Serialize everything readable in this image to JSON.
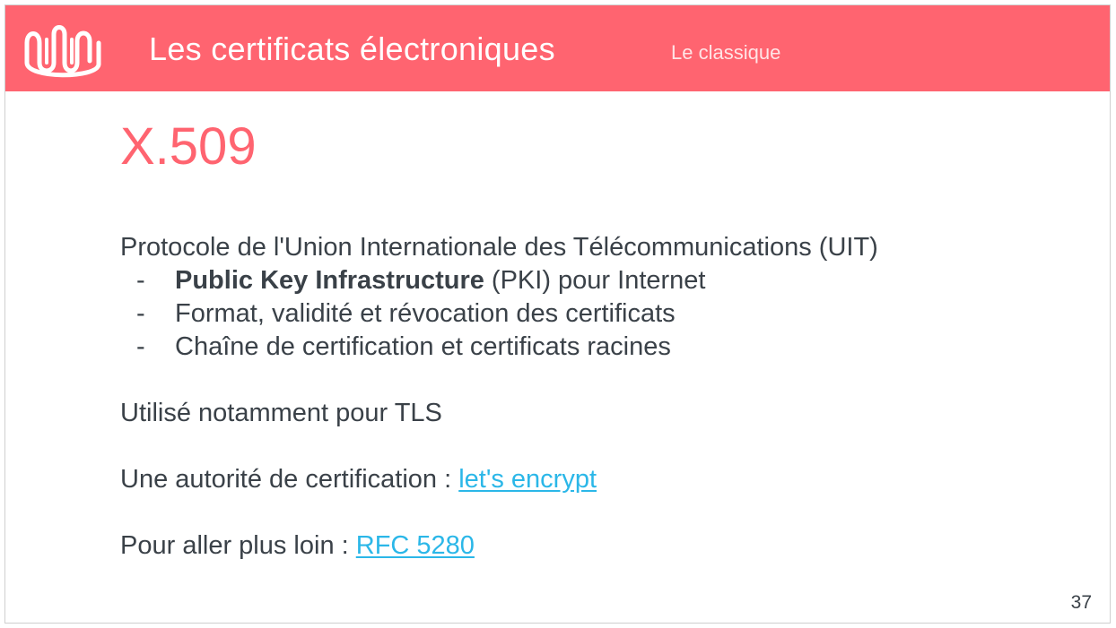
{
  "header": {
    "title": "Les certificats électroniques",
    "subtitle": "Le classique",
    "accent_color": "#ff6470",
    "logo_icon": "wavy-line-logo-icon"
  },
  "slide": {
    "title": "X.509",
    "intro": "Protocole de l'Union Internationale des Télécommunications (UIT)",
    "bullets": [
      {
        "dash": "-",
        "bold": "Public Key Infrastructure",
        "text": " (PKI) pour Internet"
      },
      {
        "dash": "-",
        "text": "Format, validité et révocation des certificats"
      },
      {
        "dash": "-",
        "text": "Chaîne de certification et certificats racines"
      }
    ],
    "usage": "Utilisé notamment pour TLS",
    "authority": {
      "label": "Une autorité de certification : ",
      "link_text": "let's encrypt"
    },
    "further": {
      "label": "Pour aller plus loin : ",
      "link_text": "RFC 5280"
    },
    "link_color": "#2bb7e8",
    "text_color": "#3a4148"
  },
  "page_number": "37"
}
